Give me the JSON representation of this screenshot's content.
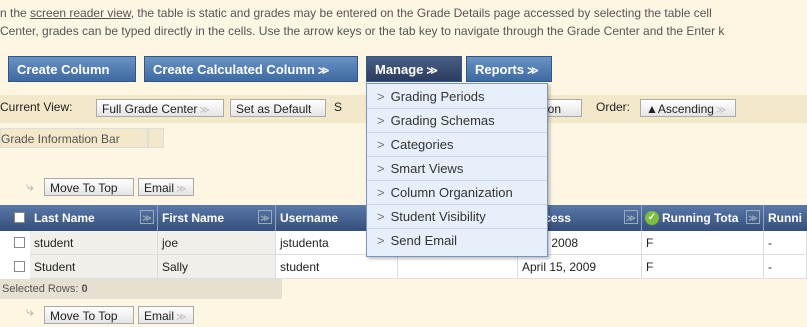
{
  "intro": {
    "line1_pre": "n the ",
    "line1_link": "screen reader view",
    "line1_post": ", the table is static and grades may be entered on the Grade Details page accessed by selecting the table cell",
    "line2": "Center, grades can be typed directly in the cells. Use the arrow keys or the tab key to navigate through the Grade Center and the Enter k"
  },
  "toolbar": {
    "create_column": "Create Column",
    "create_calculated": "Create Calculated Column",
    "manage": "Manage",
    "reports": "Reports"
  },
  "view_bar": {
    "current_view_label": "Current View:",
    "current_view_value": "Full Grade Center",
    "set_default": "Set as Default",
    "sort_label_fragment": "S",
    "sort_value_fragment": "ation",
    "order_label": "Order:",
    "order_value": "▲Ascending"
  },
  "grade_info_bar": "Grade Information Bar",
  "actions": {
    "move_to_top": "Move To Top",
    "email": "Email"
  },
  "manage_menu": [
    "Grading Periods",
    "Grading Schemas",
    "Categories",
    "Smart Views",
    "Column Organization",
    "Student Visibility",
    "Send Email"
  ],
  "table": {
    "headers": [
      "Last Name",
      "First Name",
      "Username",
      "",
      "t Access",
      "Running Tota",
      "Runni"
    ],
    "rows": [
      [
        "student",
        "joe",
        "jstudenta",
        "",
        "y 12, 2008",
        "F",
        "-"
      ],
      [
        "Student",
        "Sally",
        "student",
        "",
        "April 15, 2009",
        "F",
        "-"
      ]
    ]
  },
  "selected_rows": {
    "label": "Selected Rows:",
    "count": "0"
  },
  "colors": {
    "page_bg": "#fdf6e3",
    "toolbar_blue": "#3d6aa3",
    "toolbar_dark": "#2b3c5e",
    "menu_bg": "#e7effa"
  }
}
